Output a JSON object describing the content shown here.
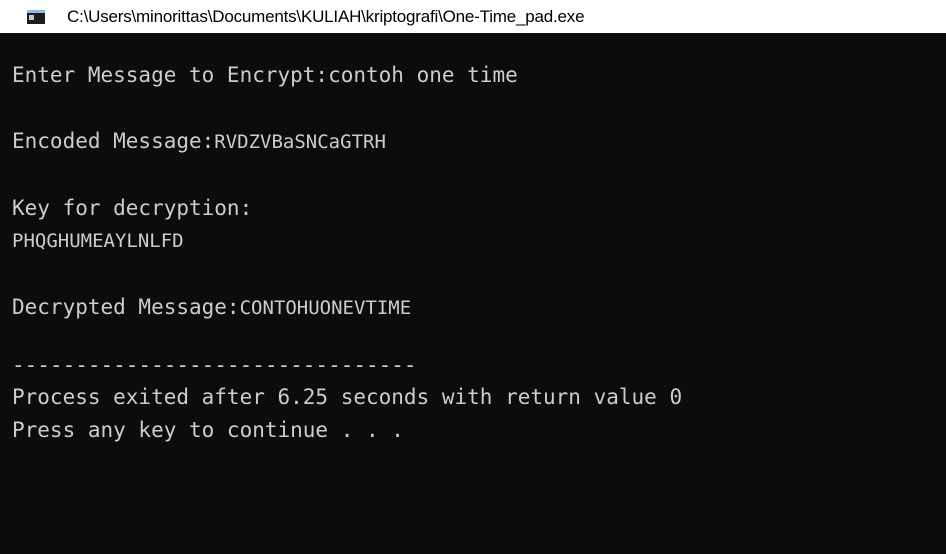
{
  "window": {
    "title": "C:\\Users\\minorittas\\Documents\\KULIAH\\kriptografi\\One-Time_pad.exe",
    "icon": "console-window-icon"
  },
  "console": {
    "prompt_label": "Enter Message to Encrypt:",
    "input_value": "contoh one time",
    "encoded_label": "Encoded Message:",
    "encoded_value": "RVDZVBaSNCaGTRH",
    "key_label": "Key for decryption:",
    "key_value": "PHQGHUMEAYLNLFD",
    "decrypted_label": "Decrypted Message:",
    "decrypted_value": "CONTOHUONEVTIME",
    "separator": "--------------------------------",
    "process_exit": "Process exited after 6.25 seconds with return value 0",
    "press_key": "Press any key to continue . . ."
  }
}
